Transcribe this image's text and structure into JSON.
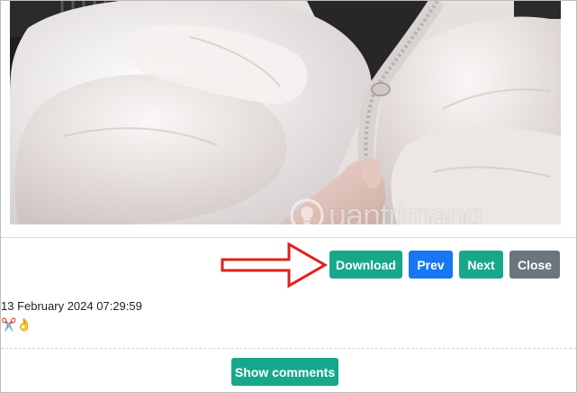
{
  "photo": {
    "alt": "White puffer jacket with zipper close-up",
    "watermark_text": "uantrimang"
  },
  "actions": {
    "download_label": "Download",
    "prev_label": "Prev",
    "next_label": "Next",
    "close_label": "Close",
    "arrow_icon": "right-arrow-icon"
  },
  "post": {
    "timestamp": "13 February 2024 07:29:59",
    "emoji": "✂️👌"
  },
  "comments": {
    "show_label": "Show comments"
  },
  "colors": {
    "teal": "#17a88b",
    "blue": "#1877f2",
    "gray": "#6c757d",
    "arrow_red": "#e0201c"
  }
}
